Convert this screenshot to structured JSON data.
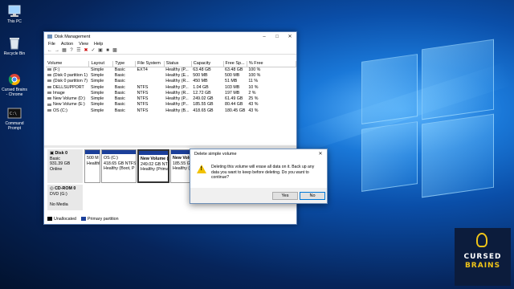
{
  "desktop": {
    "icons": [
      {
        "label": "This PC",
        "icon": "computer-icon"
      },
      {
        "label": "Recycle Bin",
        "icon": "recycle-bin-icon"
      },
      {
        "label": "Cursed Brains - Chrome",
        "icon": "chrome-icon"
      },
      {
        "label": "Command Prompt",
        "icon": "command-prompt-icon"
      }
    ]
  },
  "window": {
    "title": "Disk Management",
    "menu": [
      "File",
      "Action",
      "View",
      "Help"
    ],
    "columns": [
      "Volume",
      "Layout",
      "Type",
      "File System",
      "Status",
      "Capacity",
      "Free Sp...",
      "% Free"
    ],
    "volumes": [
      [
        "(F:)",
        "Simple",
        "Basic",
        "EXT4",
        "Healthy (P...",
        "63.48 GB",
        "63.48 GB",
        "100 %"
      ],
      [
        "(Disk 0 partition 1)",
        "Simple",
        "Basic",
        "",
        "Healthy (E...",
        "500 MB",
        "500 MB",
        "100 %"
      ],
      [
        "(Disk 0 partition 7)",
        "Simple",
        "Basic",
        "",
        "Healthy (R...",
        "450 MB",
        "51 MB",
        "11 %"
      ],
      [
        "DELLSUPPORT",
        "Simple",
        "Basic",
        "NTFS",
        "Healthy (P...",
        "1.04 GB",
        "103 MB",
        "10 %"
      ],
      [
        "Image",
        "Simple",
        "Basic",
        "NTFS",
        "Healthy (R...",
        "12.72 GB",
        "197 MB",
        "2 %"
      ],
      [
        "New Volume (D:)",
        "Simple",
        "Basic",
        "NTFS",
        "Healthy (P...",
        "249.02 GB",
        "61.49 GB",
        "25 %"
      ],
      [
        "New Volume (E:)",
        "Simple",
        "Basic",
        "NTFS",
        "Healthy (P...",
        "185.55 GB",
        "80.44 GB",
        "43 %"
      ],
      [
        "OS (C:)",
        "Simple",
        "Basic",
        "NTFS",
        "Healthy (B...",
        "418.65 GB",
        "180.45 GB",
        "43 %"
      ]
    ],
    "disk0": {
      "name": "Disk 0",
      "type": "Basic",
      "size": "931.39 GB",
      "status": "Online",
      "partitions": [
        {
          "line1": "500 M",
          "line2": "Healthl"
        },
        {
          "line1": "OS (C:)",
          "line2": "418.65 GB NTFS",
          "line3": "Healthy (Boot, P"
        },
        {
          "line1": "New Volume (",
          "line2": "249.02 GB NTFS",
          "line3": "Healthy (Primar"
        },
        {
          "line1": "New Volume (",
          "line2": "185.55 GB NTFS",
          "line3": "Healthy (Primar"
        }
      ]
    },
    "cdrom0": {
      "name": "CD-ROM 0",
      "type": "DVD (G:)",
      "status": "No Media"
    },
    "legend": [
      {
        "label": "Unallocated",
        "color": "#000000"
      },
      {
        "label": "Primary partition",
        "color": "#1b3f9a"
      }
    ]
  },
  "dialog": {
    "title": "Delete simple volume",
    "message": "Deleting this volume will erase all data on it. Back up any data you want to keep before deleting. Do you want to continue?",
    "yes_label": "Yes",
    "no_label": "No"
  },
  "brand": {
    "line1": "CURSED",
    "line2": "BRAINS"
  }
}
